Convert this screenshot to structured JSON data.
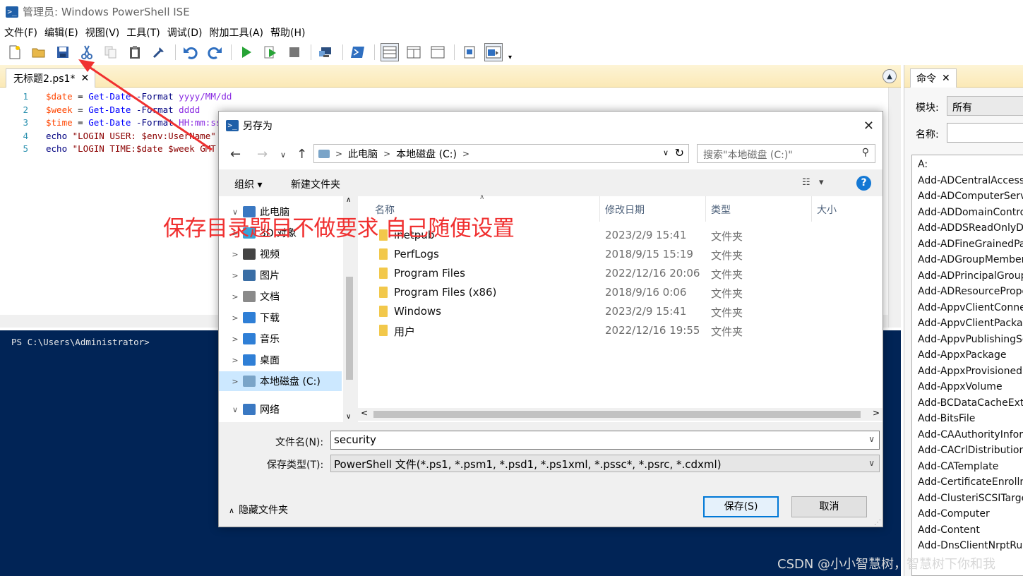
{
  "window": {
    "title": "管理员: Windows PowerShell ISE"
  },
  "menu": [
    "文件(F)",
    "编辑(E)",
    "视图(V)",
    "工具(T)",
    "调试(D)",
    "附加工具(A)",
    "帮助(H)"
  ],
  "toolbar": {
    "icons": [
      "new-file-icon",
      "open-file-icon",
      "save-icon",
      "cut-icon",
      "copy-icon",
      "paste-icon",
      "clear-icon",
      "undo-icon",
      "redo-icon",
      "run-icon",
      "run-selection-icon",
      "stop-icon",
      "remote-icon",
      "powershell-icon",
      "layout-top-icon",
      "layout-right-icon",
      "layout-max-icon",
      "show-script-icon",
      "show-commands-icon"
    ]
  },
  "editor": {
    "tab_label": "无标题2.ps1*",
    "line_numbers": [
      "1",
      "2",
      "3",
      "4",
      "5"
    ],
    "lines": [
      {
        "var": "$date",
        "op": " = ",
        "cmd": "Get-Date",
        "param": " -Format ",
        "arg": "yyyy/MM/dd",
        "rest": ""
      },
      {
        "var": "$week",
        "op": " = ",
        "cmd": "Get-Date",
        "param": " -Format ",
        "arg": "dddd",
        "rest": ""
      },
      {
        "var": "$time",
        "op": " = ",
        "cmd": "Get-Date",
        "param": " -Format ",
        "arg": "HH:mm:ss",
        "rest": ""
      },
      {
        "kw": "echo",
        "str": " \"LOGIN USER: $env:UserName\""
      },
      {
        "kw": "echo",
        "str": " \"LOGIN TIME:$date $week GMT"
      }
    ]
  },
  "console": {
    "prompt": "PS C:\\Users\\Administrator>"
  },
  "commands_panel": {
    "tab_label": "命令",
    "module_label": "模块:",
    "module_value": "所有",
    "name_label": "名称:",
    "items": [
      "A:",
      "Add-ADCentralAccessP",
      "Add-ADComputerServi",
      "Add-ADDomainContro",
      "Add-ADDSReadOnlyDo",
      "Add-ADFineGrainedPa",
      "Add-ADGroupMember",
      "Add-ADPrincipalGroup",
      "Add-ADResourcePrope",
      "Add-AppvClientConne",
      "Add-AppvClientPackag",
      "Add-AppvPublishingSe",
      "Add-AppxPackage",
      "Add-AppxProvisionedP",
      "Add-AppxVolume",
      "Add-BCDataCacheExte",
      "Add-BitsFile",
      "Add-CAAuthorityInforn",
      "Add-CACrlDistribution",
      "Add-CATemplate",
      "Add-CertificateEnrollm",
      "Add-ClusteriSCSITarge",
      "Add-Computer",
      "Add-Content",
      "Add-DnsClientNrptRule"
    ]
  },
  "annotation": {
    "text": "保存目录题目不做要求 自己随便设置"
  },
  "dialog": {
    "title": "另存为",
    "breadcrumb": [
      "此电脑",
      "本地磁盘 (C:)"
    ],
    "search_placeholder": "搜索\"本地磁盘 (C:)\"",
    "organize_label": "组织 ▾",
    "new_folder_label": "新建文件夹",
    "tree": [
      {
        "label": "此电脑",
        "icon_color": "#3a78c2",
        "expander": "∨"
      },
      {
        "label": "3D 对象",
        "icon_color": "#36a3d9",
        "expander": ">"
      },
      {
        "label": "视频",
        "icon_color": "#444444",
        "expander": ">"
      },
      {
        "label": "图片",
        "icon_color": "#3a6ea5",
        "expander": ">"
      },
      {
        "label": "文档",
        "icon_color": "#8a8a8a",
        "expander": ">"
      },
      {
        "label": "下载",
        "icon_color": "#2f7fd6",
        "expander": ">"
      },
      {
        "label": "音乐",
        "icon_color": "#2f7fd6",
        "expander": ">"
      },
      {
        "label": "桌面",
        "icon_color": "#2f7fd6",
        "expander": ">"
      },
      {
        "label": "本地磁盘 (C:)",
        "icon_color": "#7aa4c8",
        "expander": ">"
      },
      {
        "label": "网络",
        "icon_color": "#3a78c2",
        "expander": "∨"
      }
    ],
    "columns": [
      "名称",
      "修改日期",
      "类型",
      "大小"
    ],
    "files": [
      {
        "name": "inetpub",
        "date": "2023/2/9 15:41",
        "type": "文件夹"
      },
      {
        "name": "PerfLogs",
        "date": "2018/9/15 15:19",
        "type": "文件夹"
      },
      {
        "name": "Program Files",
        "date": "2022/12/16 20:06",
        "type": "文件夹"
      },
      {
        "name": "Program Files (x86)",
        "date": "2018/9/16 0:06",
        "type": "文件夹"
      },
      {
        "name": "Windows",
        "date": "2023/2/9 15:41",
        "type": "文件夹"
      },
      {
        "name": "用户",
        "date": "2022/12/16 19:55",
        "type": "文件夹"
      }
    ],
    "filename_label": "文件名(N):",
    "filename_value": "security",
    "filetype_label": "保存类型(T):",
    "filetype_value": "PowerShell 文件(*.ps1, *.psm1, *.psd1, *.ps1xml, *.pssc*, *.psrc, *.cdxml)",
    "hide_folders_label": "隐藏文件夹",
    "save_label": "保存(S)",
    "cancel_label": "取消"
  },
  "watermark": "CSDN @小小智慧树，智慧树下你和我",
  "colors": {
    "accent": "#0078d7",
    "console_bg": "#012456",
    "annotation": "#f03030"
  }
}
